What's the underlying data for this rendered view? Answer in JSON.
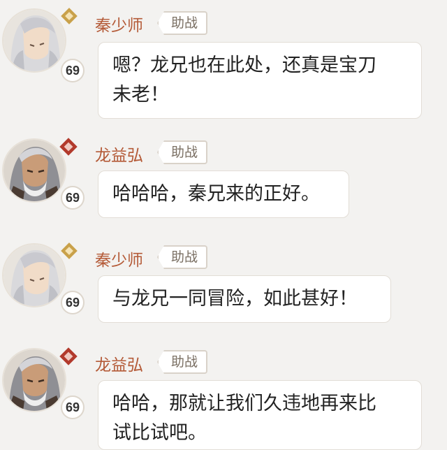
{
  "messages": [
    {
      "speaker": "秦少师",
      "tag": "助战",
      "level": "69",
      "avatar_icon": "white-haired-scholar-avatar",
      "badge_icon": "gold-diamond-rank-icon",
      "lines": [
        "嗯？龙兄也在此处，还真是宝刀",
        "未老！"
      ]
    },
    {
      "speaker": "龙益弘",
      "tag": "助战",
      "level": "69",
      "avatar_icon": "old-warrior-avatar",
      "badge_icon": "red-diamond-rank-icon",
      "lines": [
        "哈哈哈，秦兄来的正好。"
      ]
    },
    {
      "speaker": "秦少师",
      "tag": "助战",
      "level": "69",
      "avatar_icon": "white-haired-scholar-avatar",
      "badge_icon": "gold-diamond-rank-icon",
      "lines": [
        "与龙兄一同冒险，如此甚好！"
      ]
    },
    {
      "speaker": "龙益弘",
      "tag": "助战",
      "level": "69",
      "avatar_icon": "old-warrior-avatar",
      "badge_icon": "red-diamond-rank-icon",
      "lines": [
        "哈哈，那就让我们久违地再来比",
        "试比试吧。"
      ]
    }
  ],
  "colors": {
    "background": "#f3f2f0",
    "name": "#b45a37",
    "gold_badge": "#c9a14a",
    "red_badge": "#b23a2c"
  }
}
